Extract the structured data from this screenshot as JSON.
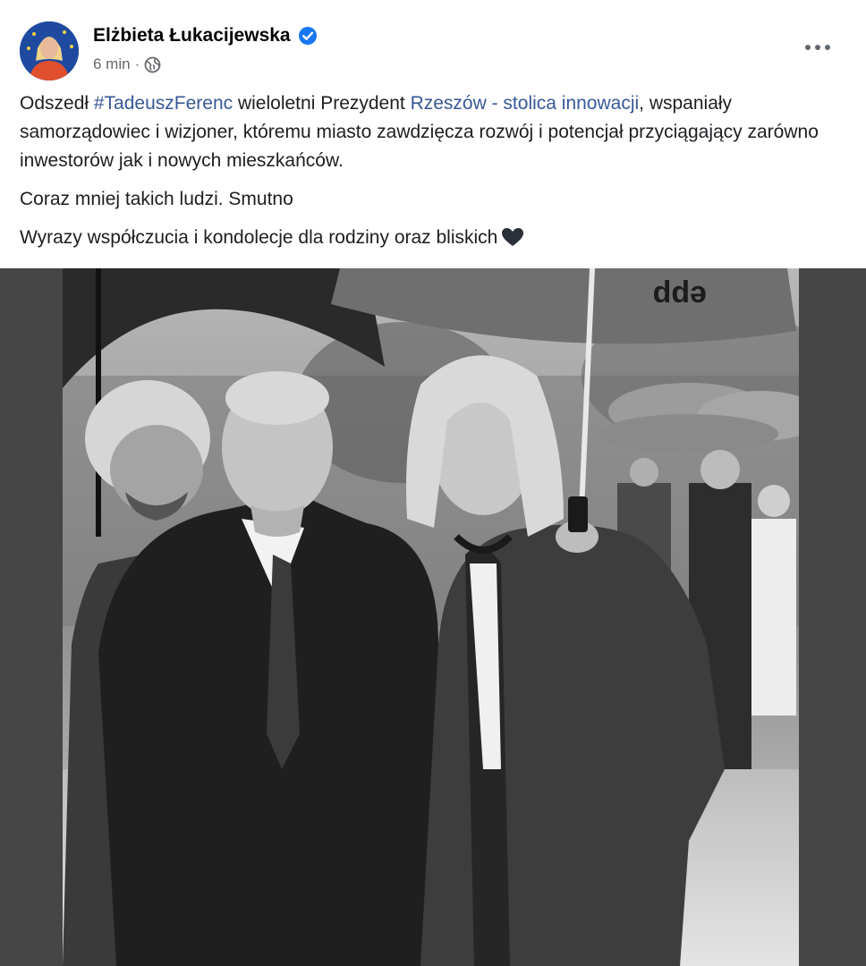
{
  "post": {
    "author": "Elżbieta Łukacijewska",
    "time": "6 min",
    "separator": "·",
    "verified_icon": "verified-badge-icon",
    "privacy_icon": "globe-icon",
    "more_icon": "more-options-icon",
    "accent_color": "#1877f2",
    "link_color": "#385898"
  },
  "text": {
    "p1_part1": "Odszedł ",
    "hashtag": "#TadeuszFerenc",
    "p1_part2": " wieloletni Prezydent ",
    "page_link": "Rzeszów - stolica innowacji",
    "p1_part3": ", wspaniały samorządowiec i wizjoner, któremu miasto zawdzięcza rozwój i potencjał przyciągający zarówno inwestorów jak i nowych mieszkańców.",
    "p2": "Coraz mniej takich ludzi. Smutno",
    "p3": "Wyrazy współczucia i kondolecje dla rodziny oraz bliskich",
    "emoji_icon": "black-heart-icon"
  },
  "photo": {
    "umbrella_print": "epp",
    "style": "black-and-white"
  }
}
